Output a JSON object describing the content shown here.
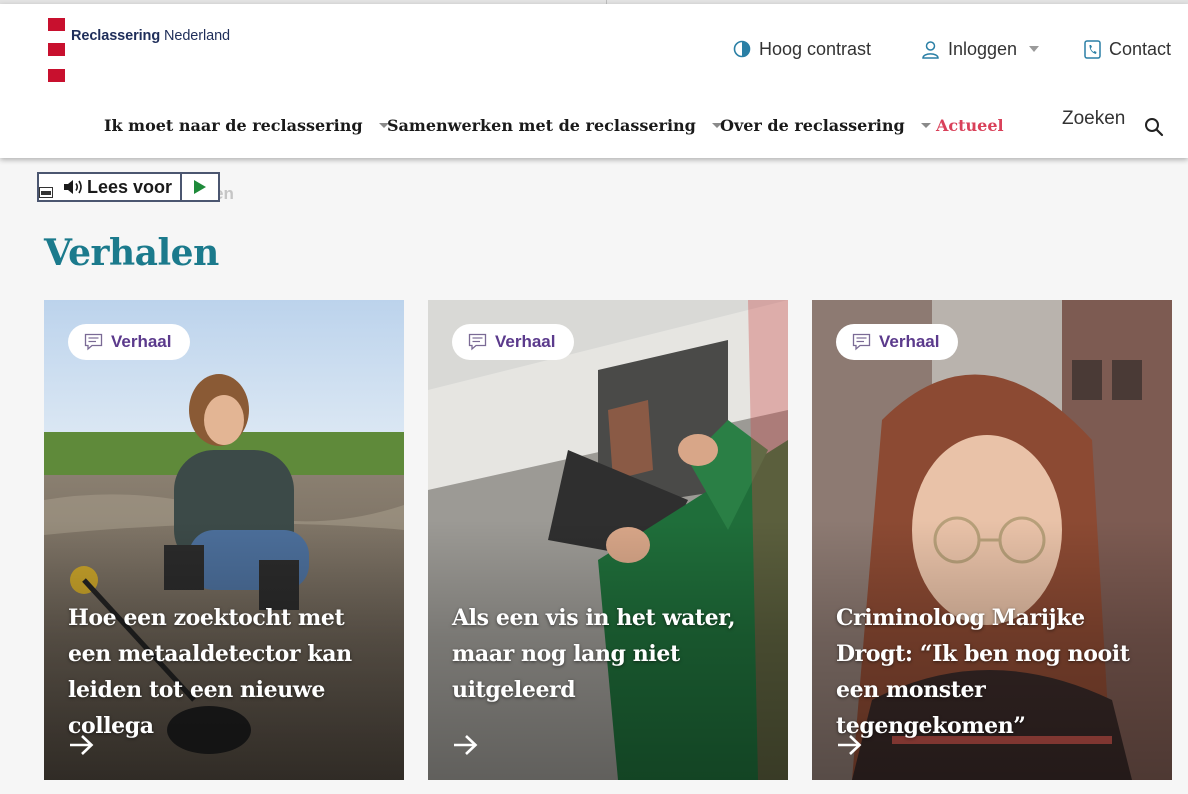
{
  "brand": {
    "name_bold": "Reclassering",
    "name_rest": " Nederland",
    "color_red": "#c8102e",
    "color_navy": "#1f2e5a"
  },
  "utility": {
    "contrast": "Hoog contrast",
    "login": "Inloggen",
    "contact": "Contact"
  },
  "nav": {
    "items": [
      {
        "label": "Ik moet naar de reclassering",
        "dropdown": true
      },
      {
        "label": "Samenwerken met de reclassering",
        "dropdown": true
      },
      {
        "label": "Over de reclassering",
        "dropdown": true
      },
      {
        "label": "Actueel",
        "dropdown": false,
        "active": true
      }
    ],
    "search_label": "Zoeken"
  },
  "readspeaker": {
    "label": "Lees voor",
    "breadcrumb_fragment": "en"
  },
  "page": {
    "title": "Verhalen",
    "title_color": "#1b7a8c"
  },
  "cards": [
    {
      "tag": "Verhaal",
      "title": "Hoe een zoektocht met een metaaldetector kan leiden tot een nieuwe collega",
      "image": "woman-with-metal-detector-photo"
    },
    {
      "tag": "Verhaal",
      "title": "Als een vis in het water, maar nog lang niet uitgeleerd",
      "image": "person-fixing-wall-photo"
    },
    {
      "tag": "Verhaal",
      "title": "Criminoloog Marijke Drogt: “Ik ben nog nooit een monster tegengekomen”",
      "image": "portrait-woman-glasses-photo"
    }
  ]
}
